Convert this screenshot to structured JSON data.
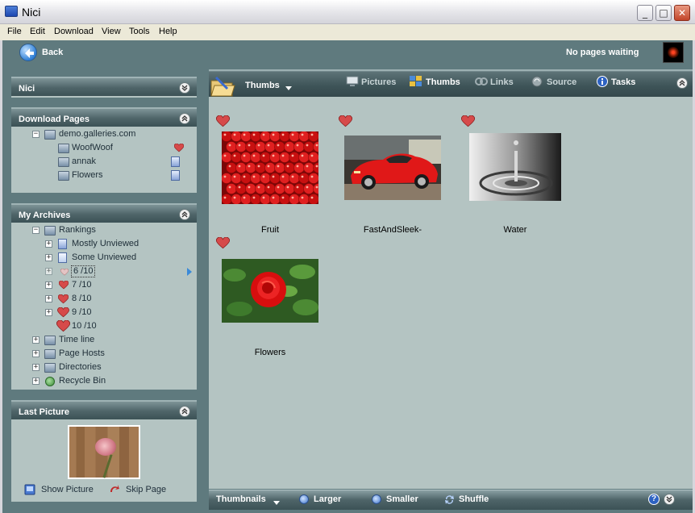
{
  "window": {
    "title": "Nici",
    "buttons": {
      "minimize": "_",
      "maximize": "□",
      "close": "✕"
    }
  },
  "menu": [
    "File",
    "Edit",
    "Download",
    "View",
    "Tools",
    "Help"
  ],
  "toolbar": {
    "back_label": "Back",
    "status": "No pages waiting"
  },
  "panels": {
    "nici": {
      "title": "Nici"
    },
    "download_pages": {
      "title": "Download Pages",
      "site": "demo.galleries.com",
      "items": [
        "WoofWoof",
        "annak",
        "Flowers"
      ]
    },
    "archives": {
      "title": "My Archives",
      "rankings": "Rankings",
      "ranking_items": [
        "Mostly Unviewed",
        "Some Unviewed",
        "6 /10",
        "7 /10",
        "8 /10",
        "9 /10",
        "10 /10"
      ],
      "other_items": [
        "Time line",
        "Page Hosts",
        "Directories",
        "Recycle Bin"
      ]
    },
    "last_picture": {
      "title": "Last Picture",
      "show_label": "Show Picture",
      "skip_label": "Skip Page"
    }
  },
  "main": {
    "view_title": "Thumbs",
    "tabs": [
      "Pictures",
      "Thumbs",
      "Links",
      "Source",
      "Tasks"
    ],
    "active_tab": "Thumbs",
    "thumbnails": [
      {
        "caption": "Fruit",
        "icon": "cranberries-photo"
      },
      {
        "caption": "FastAndSleek-",
        "icon": "red-sports-car-photo"
      },
      {
        "caption": "Water",
        "icon": "water-drop-photo"
      },
      {
        "caption": "Flowers",
        "icon": "red-rose-photo"
      }
    ],
    "bottom": {
      "mode": "Thumbnails",
      "larger": "Larger",
      "smaller": "Smaller",
      "shuffle": "Shuffle",
      "help": "?"
    }
  },
  "colors": {
    "panel_bg": "#b4c4c2",
    "header_dark": "#3c5256",
    "frame": "#5f7a7e",
    "heart": "#d64a4a"
  }
}
